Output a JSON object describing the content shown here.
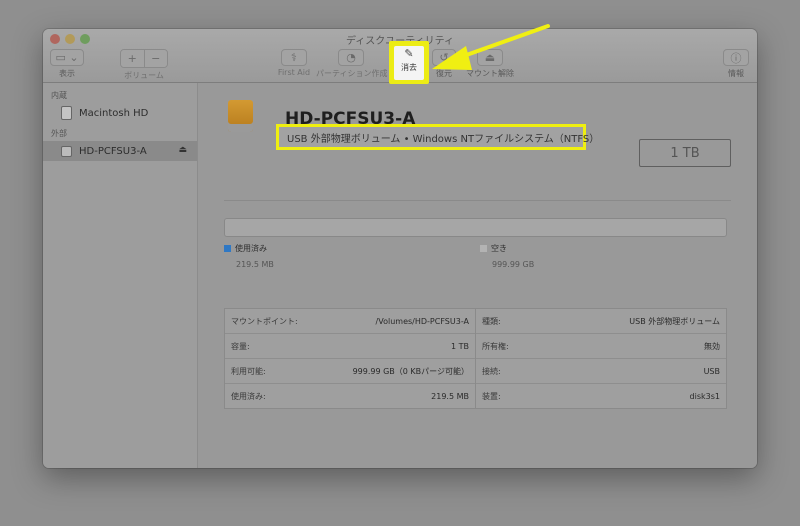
{
  "window": {
    "title": "ディスクユーティリティ"
  },
  "toolbar": {
    "view_label": "表示",
    "volume_label": "ボリューム",
    "first_aid_label": "First Aid",
    "partition_label": "パーティション作成",
    "erase_label": "消去",
    "restore_label": "復元",
    "unmount_label": "マウント解除",
    "info_label": "情報"
  },
  "sidebar": {
    "internal_header": "内蔵",
    "external_header": "外部",
    "items": [
      {
        "label": "Macintosh HD"
      },
      {
        "label": "HD-PCFSU3-A"
      }
    ]
  },
  "disk": {
    "name": "HD-PCFSU3-A",
    "subtitle": "USB 外部物理ボリューム • Windows NTファイルシステム（NTFS）",
    "capacity": "1 TB"
  },
  "usage": {
    "used_label": "使用済み",
    "used_value": "219.5 MB",
    "free_label": "空き",
    "free_value": "999.99 GB",
    "used_color": "#2f78c4"
  },
  "info": {
    "left": [
      {
        "key": "マウントポイント:",
        "value": "/Volumes/HD-PCFSU3-A"
      },
      {
        "key": "容量:",
        "value": "1 TB"
      },
      {
        "key": "利用可能:",
        "value": "999.99 GB（0 KBパージ可能）"
      },
      {
        "key": "使用済み:",
        "value": "219.5 MB"
      }
    ],
    "right": [
      {
        "key": "種類:",
        "value": "USB 外部物理ボリューム"
      },
      {
        "key": "所有権:",
        "value": "無効"
      },
      {
        "key": "接続:",
        "value": "USB"
      },
      {
        "key": "装置:",
        "value": "disk3s1"
      }
    ]
  },
  "annotation": {
    "color": "#f0ef12"
  }
}
